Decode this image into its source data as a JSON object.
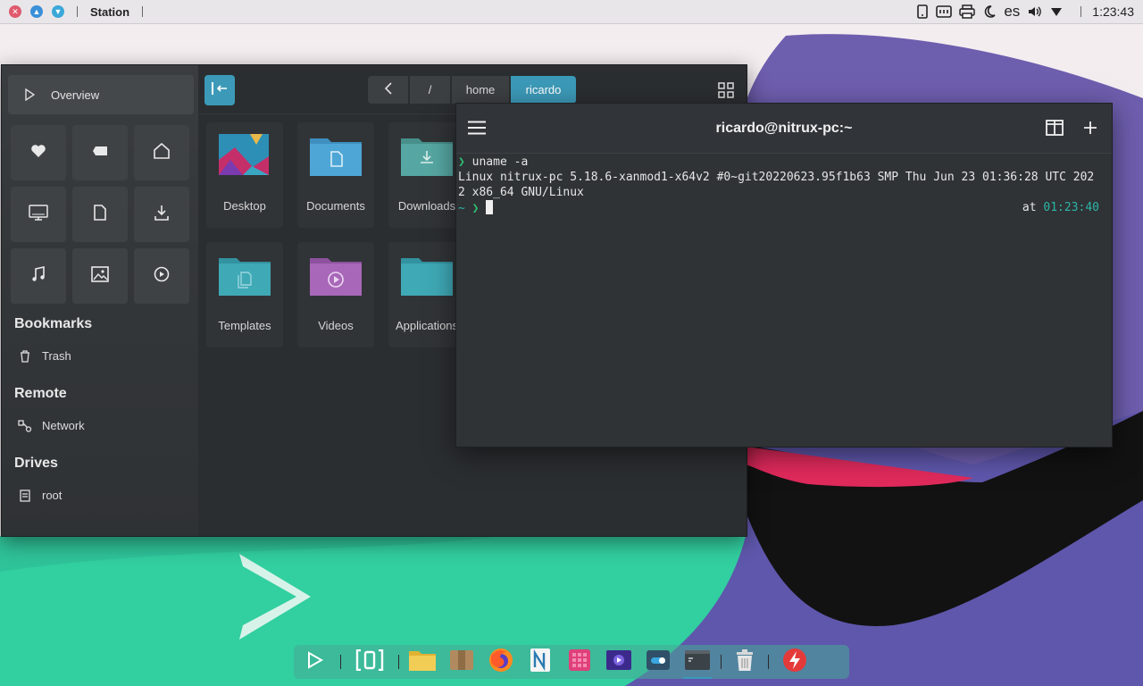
{
  "topbar": {
    "app_title": "Station",
    "language": "es",
    "clock": "1:23:43"
  },
  "file_manager": {
    "overview_label": "Overview",
    "breadcrumbs": [
      "/",
      "home",
      "ricardo"
    ],
    "quick_icons": [
      "heart-icon",
      "tag-icon",
      "home-icon",
      "desktop-icon",
      "document-icon",
      "download-icon",
      "music-icon",
      "image-icon",
      "video-icon"
    ],
    "sections": {
      "bookmarks": "Bookmarks",
      "remote": "Remote",
      "drives": "Drives"
    },
    "bookmarks_items": [
      "Trash"
    ],
    "remote_items": [
      "Network"
    ],
    "drives_items": [
      "root"
    ],
    "folders": [
      {
        "label": "Desktop",
        "color": "#e8b84a"
      },
      {
        "label": "Documents",
        "color": "#4ea6d6"
      },
      {
        "label": "Downloads",
        "color": "#56a7a3"
      },
      {
        "label": "Templates",
        "color": "#3fa9b6"
      },
      {
        "label": "Videos",
        "color": "#a867b8"
      },
      {
        "label": "Applications",
        "color": "#3fa9b6"
      }
    ]
  },
  "terminal": {
    "title": "ricardo@nitrux-pc:~",
    "prompt_symbol": "❯",
    "command": "uname -a",
    "output_line1": "Linux nitrux-pc 5.18.6-xanmod1-x64v2 #0~git20220623.95f1b63 SMP Thu Jun 23 01:36:28 UTC 202",
    "output_line2": "2 x86_64 GNU/Linux",
    "cwd": "~",
    "time_label": "at",
    "time_value": "01:23:40"
  },
  "colors": {
    "accent": "#3c9ab8",
    "close_dot": "#e05a6e",
    "min_dot": "#3a8fd8",
    "max_dot": "#3aa8d8"
  }
}
